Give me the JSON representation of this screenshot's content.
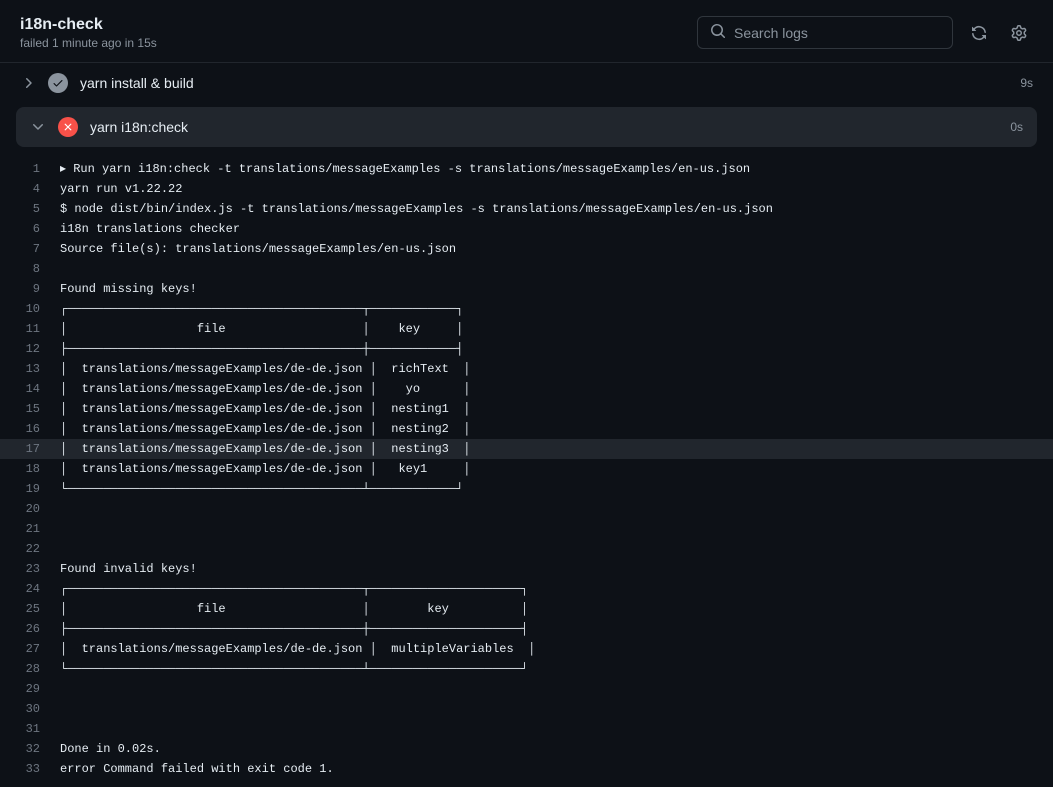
{
  "header": {
    "title": "i18n-check",
    "status": "failed 1 minute ago in 15s",
    "search_placeholder": "Search logs"
  },
  "steps": [
    {
      "name": "yarn install & build",
      "status": "success",
      "duration": "9s",
      "expanded": false
    },
    {
      "name": "yarn i18n:check",
      "status": "failure",
      "duration": "0s",
      "expanded": true
    }
  ],
  "log_lines": [
    {
      "num": "1",
      "content": "▸ Run yarn i18n:check -t translations/messageExamples -s translations/messageExamples/en-us.json",
      "hl": false
    },
    {
      "num": "4",
      "content": "yarn run v1.22.22",
      "hl": false
    },
    {
      "num": "5",
      "content": "$ node dist/bin/index.js -t translations/messageExamples -s translations/messageExamples/en-us.json",
      "hl": false
    },
    {
      "num": "6",
      "content": "i18n translations checker",
      "hl": false
    },
    {
      "num": "7",
      "content": "Source file(s): translations/messageExamples/en-us.json",
      "hl": false
    },
    {
      "num": "8",
      "content": "",
      "hl": false
    },
    {
      "num": "9",
      "content": "Found missing keys!",
      "hl": false
    },
    {
      "num": "10",
      "content": "┌─────────────────────────────────────────┬────────────┐",
      "hl": false
    },
    {
      "num": "11",
      "content": "│                  file                   │    key     │",
      "hl": false
    },
    {
      "num": "12",
      "content": "├─────────────────────────────────────────┼────────────┤",
      "hl": false
    },
    {
      "num": "13",
      "content": "│  translations/messageExamples/de-de.json │  richText  │",
      "hl": false
    },
    {
      "num": "14",
      "content": "│  translations/messageExamples/de-de.json │    yo      │",
      "hl": false
    },
    {
      "num": "15",
      "content": "│  translations/messageExamples/de-de.json │  nesting1  │",
      "hl": false
    },
    {
      "num": "16",
      "content": "│  translations/messageExamples/de-de.json │  nesting2  │",
      "hl": false
    },
    {
      "num": "17",
      "content": "│  translations/messageExamples/de-de.json │  nesting3  │",
      "hl": true
    },
    {
      "num": "18",
      "content": "│  translations/messageExamples/de-de.json │   key1     │",
      "hl": false
    },
    {
      "num": "19",
      "content": "└─────────────────────────────────────────┴────────────┘",
      "hl": false
    },
    {
      "num": "20",
      "content": "",
      "hl": false
    },
    {
      "num": "21",
      "content": "",
      "hl": false
    },
    {
      "num": "22",
      "content": "",
      "hl": false
    },
    {
      "num": "23",
      "content": "Found invalid keys!",
      "hl": false
    },
    {
      "num": "24",
      "content": "┌─────────────────────────────────────────┬─────────────────────┐",
      "hl": false
    },
    {
      "num": "25",
      "content": "│                  file                   │        key          │",
      "hl": false
    },
    {
      "num": "26",
      "content": "├─────────────────────────────────────────┼─────────────────────┤",
      "hl": false
    },
    {
      "num": "27",
      "content": "│  translations/messageExamples/de-de.json │  multipleVariables  │",
      "hl": false
    },
    {
      "num": "28",
      "content": "└─────────────────────────────────────────┴─────────────────────┘",
      "hl": false
    },
    {
      "num": "29",
      "content": "",
      "hl": false
    },
    {
      "num": "30",
      "content": "",
      "hl": false
    },
    {
      "num": "31",
      "content": "",
      "hl": false
    },
    {
      "num": "32",
      "content": "Done in 0.02s.",
      "hl": false
    },
    {
      "num": "33",
      "content": "error Command failed with exit code 1.",
      "hl": false
    }
  ]
}
